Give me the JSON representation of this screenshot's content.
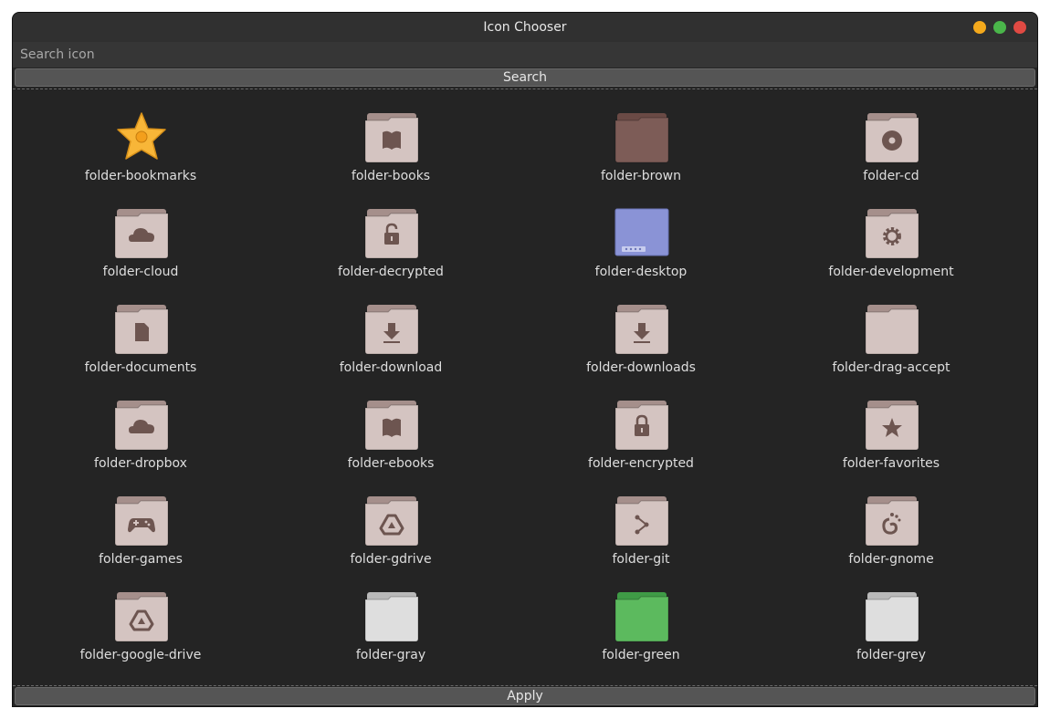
{
  "window": {
    "title": "Icon Chooser"
  },
  "controls": {
    "minimize_color": "#f4a91c",
    "maximize_color": "#4ab54a",
    "close_color": "#e04a43"
  },
  "search": {
    "placeholder": "Search icon",
    "value": "",
    "button_label": "Search"
  },
  "apply_label": "Apply",
  "icons": [
    {
      "label": "folder-bookmarks",
      "icon": "bookmark-star"
    },
    {
      "label": "folder-books",
      "icon": "folder-book"
    },
    {
      "label": "folder-brown",
      "icon": "folder-plain-brown"
    },
    {
      "label": "folder-cd",
      "icon": "folder-cd"
    },
    {
      "label": "folder-cloud",
      "icon": "folder-cloud"
    },
    {
      "label": "folder-decrypted",
      "icon": "folder-unlock"
    },
    {
      "label": "folder-desktop",
      "icon": "folder-desktop"
    },
    {
      "label": "folder-development",
      "icon": "folder-gear"
    },
    {
      "label": "folder-documents",
      "icon": "folder-document"
    },
    {
      "label": "folder-download",
      "icon": "folder-download"
    },
    {
      "label": "folder-downloads",
      "icon": "folder-download"
    },
    {
      "label": "folder-drag-accept",
      "icon": "folder-open"
    },
    {
      "label": "folder-dropbox",
      "icon": "folder-cloud"
    },
    {
      "label": "folder-ebooks",
      "icon": "folder-book"
    },
    {
      "label": "folder-encrypted",
      "icon": "folder-lock"
    },
    {
      "label": "folder-favorites",
      "icon": "folder-star"
    },
    {
      "label": "folder-games",
      "icon": "folder-gamepad"
    },
    {
      "label": "folder-gdrive",
      "icon": "folder-drive"
    },
    {
      "label": "folder-git",
      "icon": "folder-git"
    },
    {
      "label": "folder-gnome",
      "icon": "folder-gnome"
    },
    {
      "label": "folder-google-drive",
      "icon": "folder-drive"
    },
    {
      "label": "folder-gray",
      "icon": "folder-plain-gray"
    },
    {
      "label": "folder-green",
      "icon": "folder-plain-green"
    },
    {
      "label": "folder-grey",
      "icon": "folder-plain-gray"
    }
  ]
}
